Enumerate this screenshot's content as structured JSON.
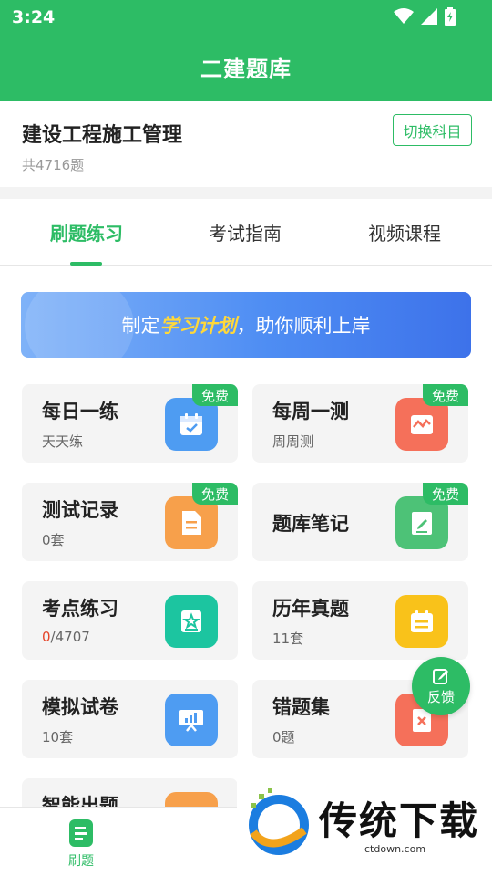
{
  "status_bar": {
    "time": "3:24"
  },
  "header": {
    "title": "二建题库"
  },
  "subject": {
    "name": "建设工程施工管理",
    "count": "共4716题",
    "switch_label": "切换科目"
  },
  "tabs": [
    {
      "label": "刷题练习",
      "active": true
    },
    {
      "label": "考试指南",
      "active": false
    },
    {
      "label": "视频课程",
      "active": false
    }
  ],
  "banner": {
    "prefix": "制定",
    "highlight": "学习计划",
    "suffix": "，助你顺利上岸"
  },
  "cards": [
    {
      "title": "每日一练",
      "sub": "天天练",
      "badge": "免费",
      "icon": "calendar-check-icon",
      "color": "#4e9cf2"
    },
    {
      "title": "每周一测",
      "sub": "周周测",
      "badge": "免费",
      "icon": "chart-wave-icon",
      "color": "#f5705a"
    },
    {
      "title": "测试记录",
      "sub": "0套",
      "badge": "免费",
      "icon": "document-icon",
      "color": "#f7a04b"
    },
    {
      "title": "题库笔记",
      "badge": "免费",
      "icon": "notebook-pen-icon",
      "color": "#4dc277"
    },
    {
      "title": "考点练习",
      "sub_done": "0",
      "sub_total": "/4707",
      "icon": "star-book-icon",
      "color": "#1cc5a0"
    },
    {
      "title": "历年真题",
      "sub": "11套",
      "icon": "calendar-list-icon",
      "color": "#f9c21a"
    },
    {
      "title": "模拟试卷",
      "sub": "10套",
      "icon": "presentation-board-icon",
      "color": "#4e9cf2"
    },
    {
      "title": "错题集",
      "sub": "0题",
      "icon": "error-document-icon",
      "color": "#f5705a"
    },
    {
      "title": "智能出题",
      "icon": "smart-question-icon",
      "color": "#f7a04b"
    }
  ],
  "feedback": {
    "label": "反馈"
  },
  "bottom_nav": [
    {
      "label": "刷题",
      "icon": "practice-doc-icon"
    }
  ],
  "watermark": {
    "text": "传统下载",
    "url": "ctdown.com"
  },
  "colors": {
    "brand": "#2dbc65",
    "danger": "#e5462b"
  }
}
